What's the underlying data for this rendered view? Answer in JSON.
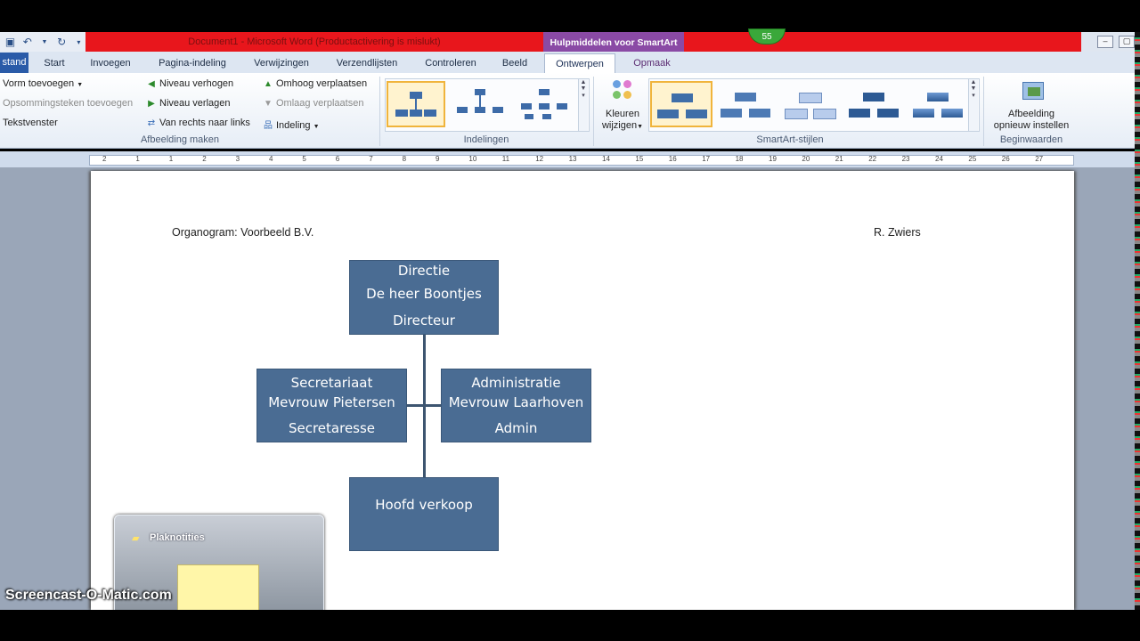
{
  "title_bar": {
    "document_title": "Document1 - Microsoft Word (Productactivering is mislukt)",
    "contextual_tab": "Hulpmiddelen voor SmartArt",
    "badge": "55"
  },
  "quick_access": {
    "save_icon": "save-icon",
    "undo_icon": "undo-icon",
    "redo_icon": "redo-icon"
  },
  "tabs": {
    "file": "stand",
    "items": [
      "Start",
      "Invoegen",
      "Pagina-indeling",
      "Verwijzingen",
      "Verzendlijsten",
      "Controleren",
      "Beeld",
      "Ontwerpen",
      "Opmaak"
    ]
  },
  "ribbon": {
    "create_graphic": {
      "add_shape": "Vorm toevoegen",
      "add_bullet": "Opsommingsteken toevoegen",
      "text_pane": "Tekstvenster",
      "promote": "Niveau verhogen",
      "demote": "Niveau verlagen",
      "right_to_left": "Van rechts naar links",
      "move_up": "Omhoog verplaatsen",
      "move_down": "Omlaag verplaatsen",
      "layout": "Indeling",
      "label": "Afbeelding maken"
    },
    "layouts": {
      "label": "Indelingen"
    },
    "styles": {
      "change_colors_line1": "Kleuren",
      "change_colors_line2": "wijzigen",
      "label": "SmartArt-stijlen"
    },
    "reset": {
      "reset_line1": "Afbeelding",
      "reset_line2": "opnieuw instellen",
      "label": "Beginwaarden"
    }
  },
  "ruler": {
    "numbers": [
      "2",
      "1",
      "1",
      "2",
      "3",
      "4",
      "5",
      "6",
      "7",
      "8",
      "9",
      "10",
      "11",
      "12",
      "13",
      "14",
      "15",
      "16",
      "17",
      "18",
      "19",
      "20",
      "21",
      "22",
      "23",
      "24",
      "25",
      "26",
      "27"
    ]
  },
  "document": {
    "header_left": "Organogram: Voorbeeld B.V.",
    "header_right": "R. Zwiers",
    "org_chart": {
      "top": {
        "line1": "Directie",
        "line2": "De heer Boontjes",
        "line3": "Directeur"
      },
      "left": {
        "line1": "Secretariaat",
        "line2": "Mevrouw Pietersen",
        "line3": "Secretaresse"
      },
      "right": {
        "line1": "Administratie",
        "line2": "Mevrouw Laarhoven",
        "line3": "Admin"
      },
      "bottom": {
        "line1": "Hoofd verkoop"
      }
    }
  },
  "taskbar_preview": {
    "title": "Plaknotities"
  },
  "watermark": "Screencast-O-Matic.com",
  "colors": {
    "box_fill": "#4a6c93",
    "title_red": "#e8161c",
    "contextual_purple": "#8a4aa5"
  }
}
